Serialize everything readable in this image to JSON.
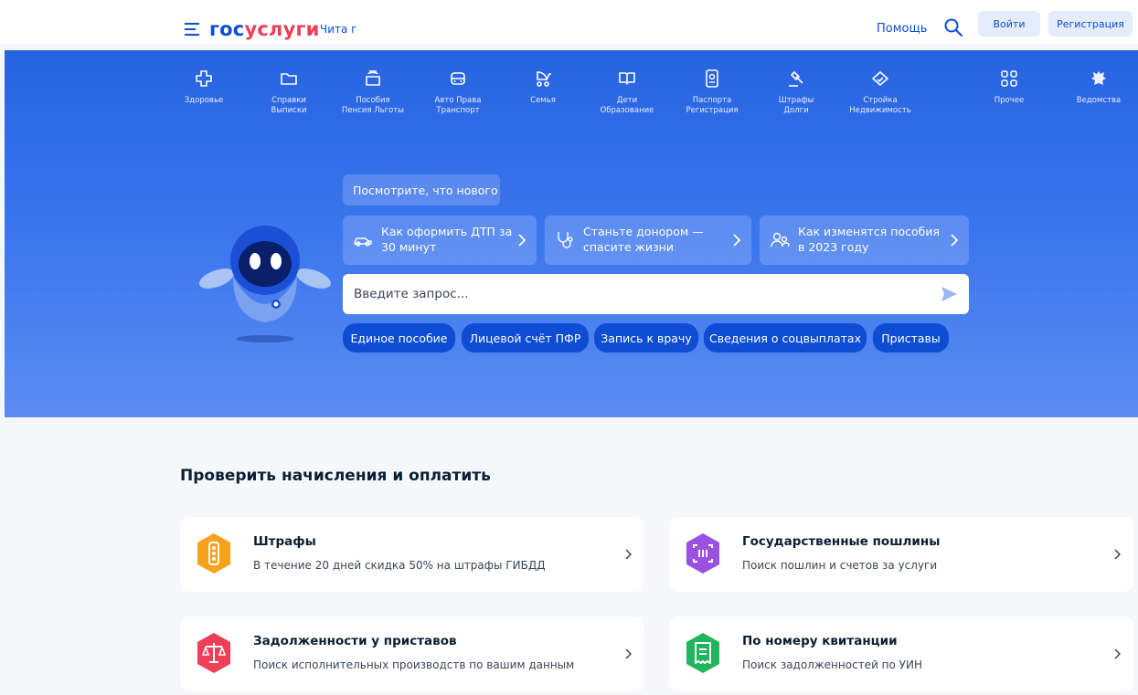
{
  "header": {
    "logo_part1": "гос",
    "logo_part2": "услуги",
    "city": "Чита г",
    "help": "Помощь",
    "login": "Войти",
    "register": "Регистрация"
  },
  "categories": [
    {
      "icon": "health-cross-icon",
      "line1": "Здоровье",
      "line2": ""
    },
    {
      "icon": "folder-icon",
      "line1": "Справки",
      "line2": "Выписки"
    },
    {
      "icon": "wallet-icon",
      "line1": "Пособия",
      "line2": "Пенсия Льготы"
    },
    {
      "icon": "car-icon",
      "line1": "Авто Права",
      "line2": "Транспорт"
    },
    {
      "icon": "stroller-icon",
      "line1": "Семья",
      "line2": ""
    },
    {
      "icon": "book-icon",
      "line1": "Дети",
      "line2": "Образование"
    },
    {
      "icon": "passport-icon",
      "line1": "Паспорта",
      "line2": "Регистрация"
    },
    {
      "icon": "gavel-icon",
      "line1": "Штрафы",
      "line2": "Долги"
    },
    {
      "icon": "house-icon",
      "line1": "Стройка",
      "line2": "Недвижимость"
    },
    {
      "icon": "grid-icon",
      "line1": "Прочее",
      "line2": ""
    },
    {
      "icon": "emblem-icon",
      "line1": "Ведомства",
      "line2": ""
    }
  ],
  "hero": {
    "news_button": "Посмотрите, что нового",
    "stories": [
      {
        "icon": "car-crash-icon",
        "text": "Как оформить ДТП за\n30 минут"
      },
      {
        "icon": "stethoscope-icon",
        "text": "Станьте донором —\nспасите жизни"
      },
      {
        "icon": "people-icon",
        "text": "Как изменятся пособия\nв 2023 году"
      }
    ],
    "search_placeholder": "Введите запрос...",
    "quick_links": [
      "Единое пособие",
      "Лицевой счёт ПФР",
      "Запись к врачу",
      "Сведения о соцвыплатах",
      "Приставы"
    ]
  },
  "payments": {
    "title": "Проверить начисления и оплатить",
    "cards": [
      {
        "icon": "traffic-light-icon",
        "color": "#f7a21b",
        "title": "Штрафы",
        "subtitle": "В течение 20 дней скидка 50% на штрафы ГИБДД"
      },
      {
        "icon": "barcode-scan-icon",
        "color": "#9b51e0",
        "title": "Государственные пошлины",
        "subtitle": "Поиск пошлин и счетов за услуги"
      },
      {
        "icon": "scales-icon",
        "color": "#ee3f58",
        "title": "Задолженности у приставов",
        "subtitle": "Поиск исполнительных производств по вашим данным"
      },
      {
        "icon": "receipt-icon",
        "color": "#1fb55b",
        "title": "По номеру квитанции",
        "subtitle": "Поиск задолженностей по УИН"
      }
    ]
  },
  "colors": {
    "brand_blue": "#0d4cd3",
    "brand_red": "#ee3f58"
  }
}
